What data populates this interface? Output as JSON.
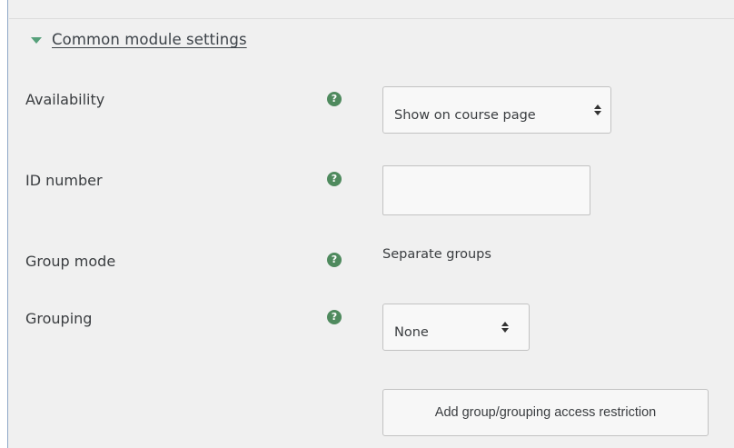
{
  "section": {
    "title": "Common module settings",
    "expanded": true,
    "icon": "caret-down-icon",
    "accent_color": "#56a07a"
  },
  "rows": {
    "availability": {
      "label": "Availability",
      "help_icon": "question-circle-icon",
      "selected": "Show on course page"
    },
    "id_number": {
      "label": "ID number",
      "help_icon": "question-circle-icon",
      "value": ""
    },
    "group_mode": {
      "label": "Group mode",
      "help_icon": "question-circle-icon",
      "value": "Separate groups"
    },
    "grouping": {
      "label": "Grouping",
      "help_icon": "question-circle-icon",
      "selected": "None"
    }
  },
  "buttons": {
    "add_restriction": "Add group/grouping access restriction"
  },
  "colors": {
    "help_icon": "#4f8a5e",
    "background": "#f0f0f0"
  }
}
